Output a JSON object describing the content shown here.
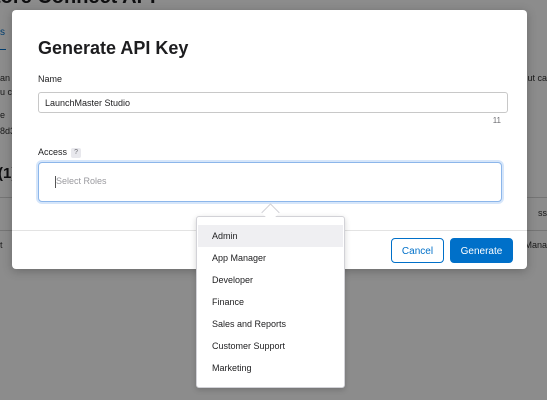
{
  "background": {
    "title": "tore Connect API",
    "link": "s",
    "left_lines": [
      "an",
      "u c",
      "e",
      "8d3"
    ],
    "right_lines": [
      "ut ca"
    ],
    "section_count": "(1)",
    "table": {
      "right_header": "ss",
      "left_cell": "t",
      "right_cell": "Mana"
    }
  },
  "modal": {
    "title": "Generate API Key",
    "name_label": "Name",
    "name_value": "LaunchMaster Studio",
    "name_char_count": "11",
    "access_label": "Access",
    "access_help": "?",
    "roles_placeholder": "Select Roles",
    "cancel_label": "Cancel",
    "generate_label": "Generate"
  },
  "roles_dropdown": {
    "items": [
      "Admin",
      "App Manager",
      "Developer",
      "Finance",
      "Sales and Reports",
      "Customer Support",
      "Marketing"
    ],
    "highlighted": "Admin"
  },
  "colors": {
    "accent": "#0070c9",
    "focus_border": "#8cb6ea"
  }
}
